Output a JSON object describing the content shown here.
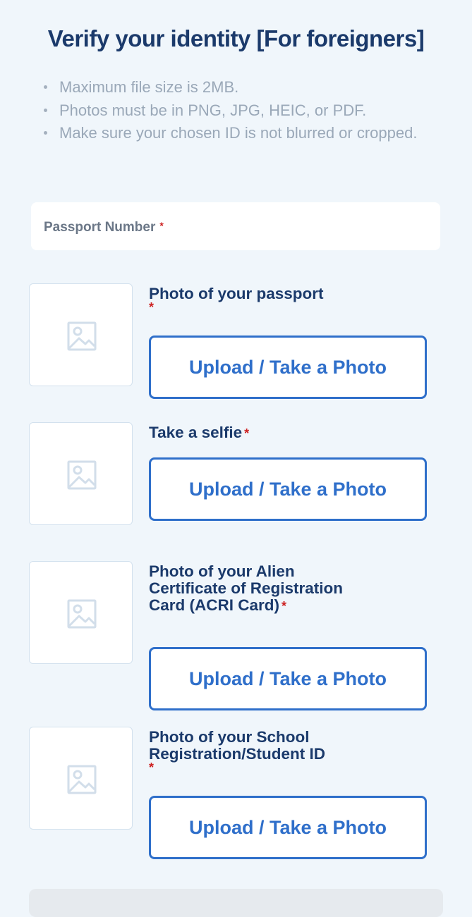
{
  "page": {
    "title": "Verify your identity [For foreigners]",
    "requirements": [
      "Maximum file size is 2MB.",
      "Photos must be in PNG, JPG, HEIC, or PDF.",
      "Make sure your chosen ID is not blurred or cropped."
    ]
  },
  "form": {
    "passport_field": {
      "label": "Passport Number",
      "required_mark": "*"
    },
    "uploads": [
      {
        "label": "Photo of your passport",
        "required_mark": "*",
        "button_label": "Upload / Take a Photo",
        "thumbnail_icon": "image-placeholder-icon"
      },
      {
        "label": "Take a selfie",
        "required_mark": "*",
        "button_label": "Upload / Take a Photo",
        "thumbnail_icon": "image-placeholder-icon"
      },
      {
        "label": "Photo of your Alien Certificate of Registration Card (ACRI Card)",
        "required_mark": "*",
        "button_label": "Upload / Take a Photo",
        "thumbnail_icon": "image-placeholder-icon"
      },
      {
        "label": "Photo of your School Registration/Student ID",
        "required_mark": "*",
        "button_label": "Upload / Take a Photo",
        "thumbnail_icon": "image-placeholder-icon"
      }
    ]
  },
  "colors": {
    "background": "#f0f6fb",
    "heading": "#1b3a6b",
    "accent": "#2f6fca",
    "required": "#cc1f1f",
    "muted_text": "#9aa8b8"
  }
}
